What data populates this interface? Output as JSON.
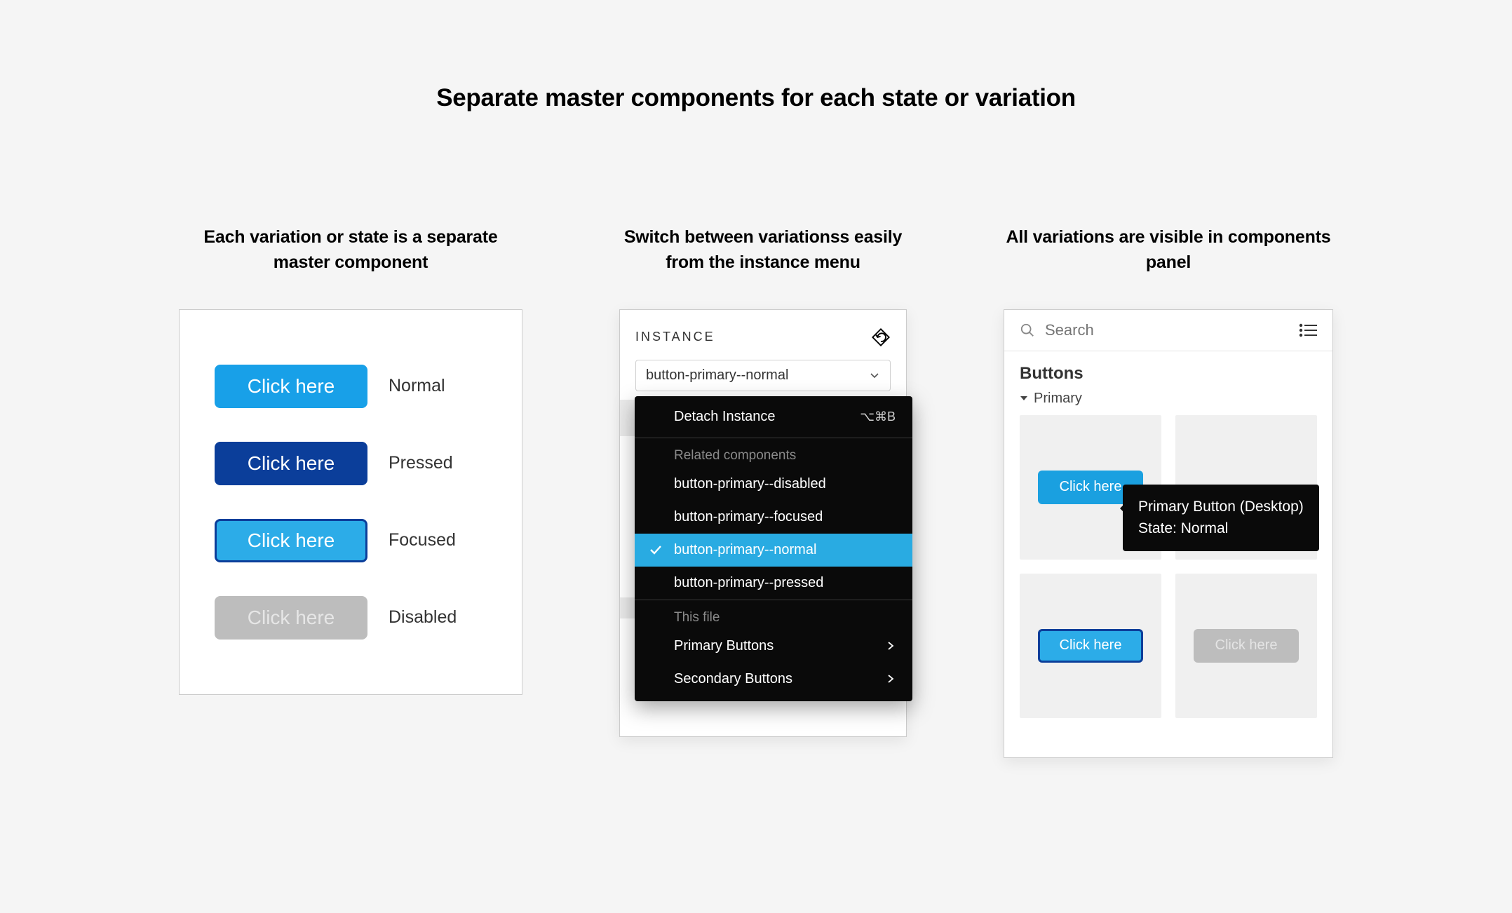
{
  "main_title": "Separate master components for each state or variation",
  "col1": {
    "subtitle": "Each variation or state is a separate master component",
    "states": [
      {
        "btn": "Click here",
        "label": "Normal",
        "class": "btn-normal"
      },
      {
        "btn": "Click here",
        "label": "Pressed",
        "class": "btn-pressed"
      },
      {
        "btn": "Click here",
        "label": "Focused",
        "class": "btn-focused"
      },
      {
        "btn": "Click here",
        "label": "Disabled",
        "class": "btn-disabled"
      }
    ]
  },
  "col2": {
    "subtitle": "Switch between variationss easily from the instance menu",
    "panel_title": "INSTANCE",
    "selected": "button-primary--normal",
    "detach": {
      "label": "Detach Instance",
      "shortcut": "⌥⌘B"
    },
    "related_label": "Related components",
    "related": [
      "button-primary--disabled",
      "button-primary--focused",
      "button-primary--normal",
      "button-primary--pressed"
    ],
    "related_selected_index": 2,
    "this_file_label": "This file",
    "this_file": [
      "Primary Buttons",
      "Secondary Buttons"
    ]
  },
  "col3": {
    "subtitle": "All variations are visible in components panel",
    "search_placeholder": "Search",
    "section": "Buttons",
    "tree_item": "Primary",
    "tooltip_line1": "Primary Button (Desktop)",
    "tooltip_line2": "State: Normal",
    "cells": [
      {
        "label": "Click here",
        "class": "mini-normal"
      },
      {
        "label": "",
        "class": ""
      },
      {
        "label": "Click here",
        "class": "mini-focused"
      },
      {
        "label": "Click here",
        "class": "mini-disabled"
      }
    ]
  }
}
